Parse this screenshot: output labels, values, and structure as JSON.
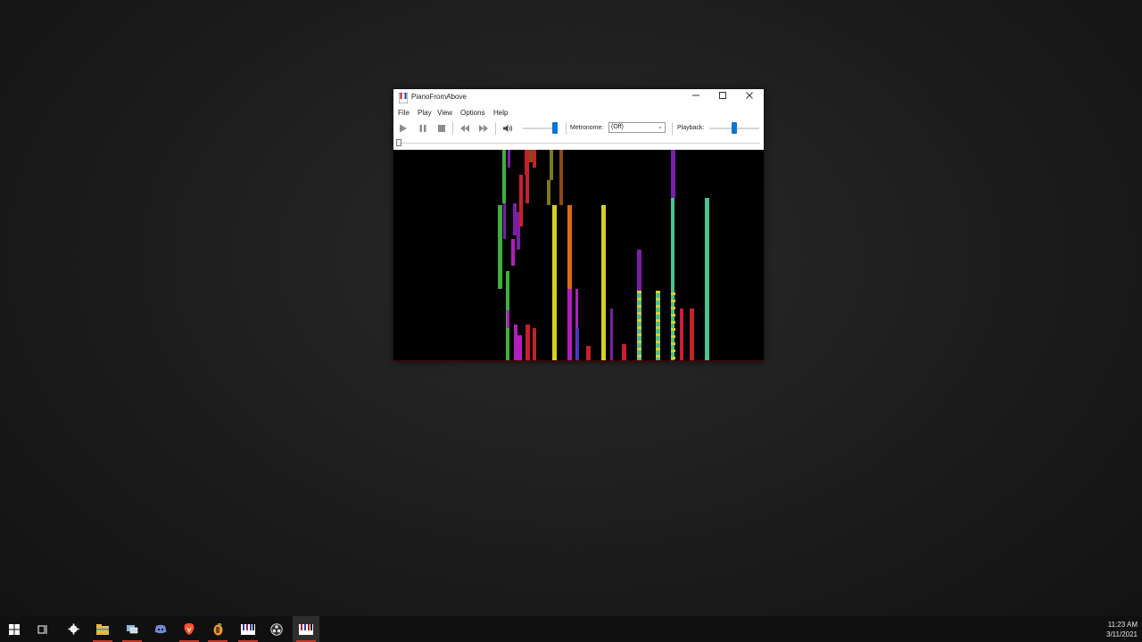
{
  "window": {
    "title": "PianoFromAbove",
    "menu": [
      "File",
      "Play",
      "View",
      "Options",
      "Help"
    ],
    "toolbar": {
      "metronome_label": "Metronome:",
      "metronome_value": "(Off)",
      "playback_label": "Playback:",
      "volume_level": 0.9,
      "playback_speed_level": 0.5
    },
    "progress_level": 0.0
  },
  "notes_palette": {
    "green": "#3fae3f",
    "purple": "#7a1fa8",
    "magenta": "#b11fb8",
    "red": "#c8202a",
    "yellow": "#d8d020",
    "orange": "#d86a18",
    "teal": "#4fc090",
    "olive": "#7c7a20",
    "blue": "#3a3ac0",
    "brown": "#8a4a18"
  },
  "taskbar": {
    "apps": [
      "start-icon",
      "task-view-icon",
      "settings-icon",
      "file-explorer-icon",
      "network-app-icon",
      "discord-icon",
      "brave-icon",
      "fl-studio-icon",
      "piano-app-icon",
      "obs-icon",
      "pianofromabove-icon"
    ],
    "time": "11:23 AM",
    "date": "3/11/2021"
  },
  "colors": {
    "accent": "#0a74d4"
  }
}
